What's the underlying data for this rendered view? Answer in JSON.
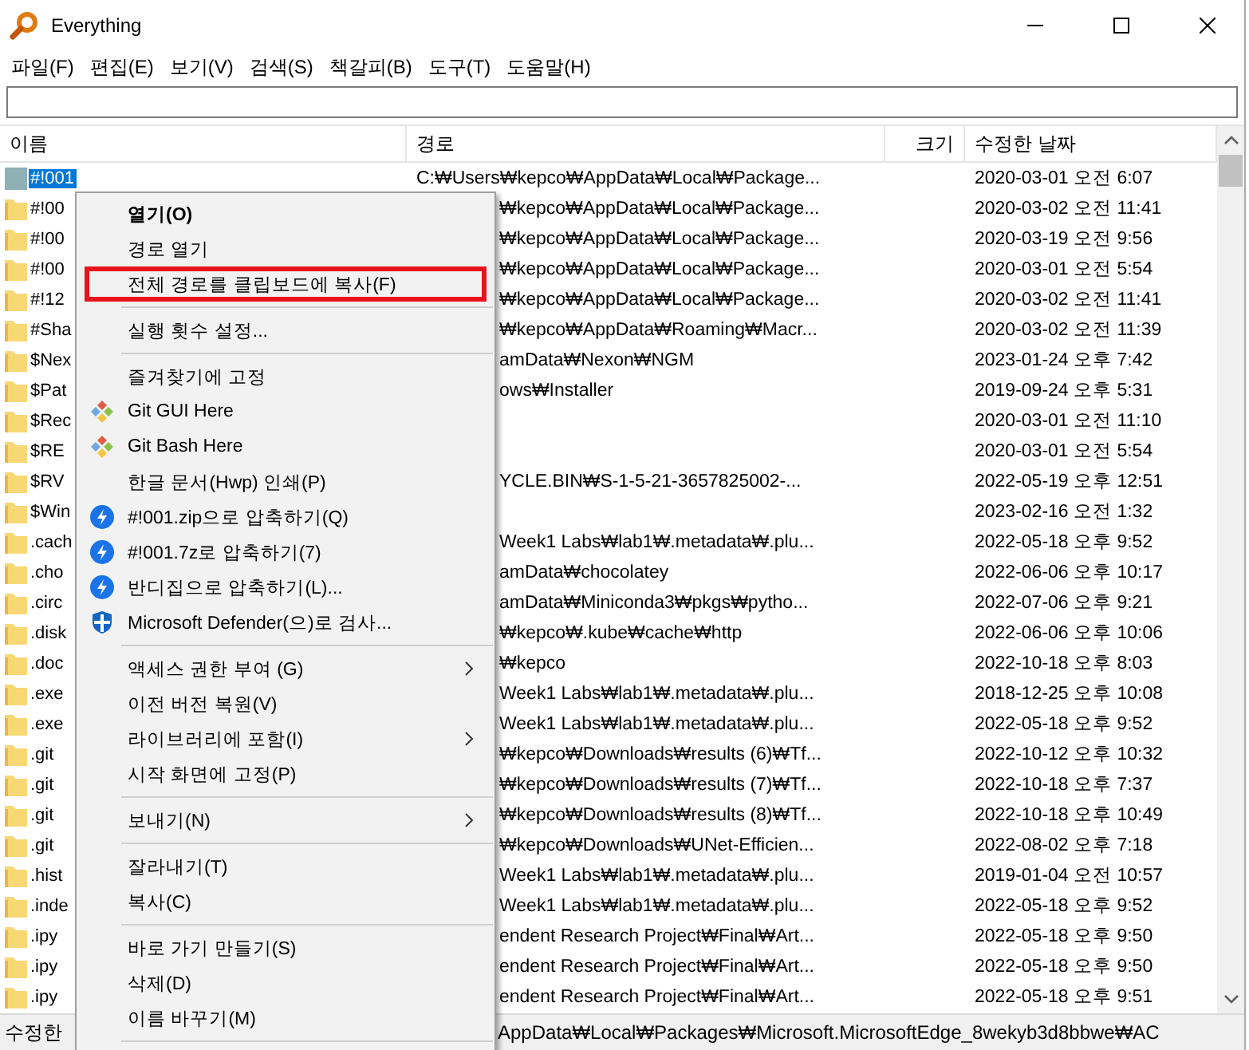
{
  "window": {
    "title": "Everything"
  },
  "menu_bar": [
    "파일(F)",
    "편집(E)",
    "보기(V)",
    "검색(S)",
    "책갈피(B)",
    "도구(T)",
    "도움말(H)"
  ],
  "columns": [
    "이름",
    "경로",
    "크기",
    "수정한 날짜"
  ],
  "rows": [
    {
      "kind": "file",
      "name": "#!001",
      "path": "C:₩Users₩kepco₩AppData₩Local₩Package...",
      "date": "2020-03-01 오전 6:07",
      "selected": true
    },
    {
      "kind": "folder",
      "name": "#!00",
      "path": "₩kepco₩AppData₩Local₩Package...",
      "date": "2020-03-02 오전 11:41",
      "selected": false
    },
    {
      "kind": "folder",
      "name": "#!00",
      "path": "₩kepco₩AppData₩Local₩Package...",
      "date": "2020-03-19 오전 9:56",
      "selected": false
    },
    {
      "kind": "folder",
      "name": "#!00",
      "path": "₩kepco₩AppData₩Local₩Package...",
      "date": "2020-03-01 오전 5:54",
      "selected": false
    },
    {
      "kind": "folder",
      "name": "#!12",
      "path": "₩kepco₩AppData₩Local₩Package...",
      "date": "2020-03-02 오전 11:41",
      "selected": false
    },
    {
      "kind": "folder",
      "name": "#Sha",
      "path": "₩kepco₩AppData₩Roaming₩Macr...",
      "date": "2020-03-02 오전 11:39",
      "selected": false
    },
    {
      "kind": "folder",
      "name": "$Nex",
      "path": "amData₩Nexon₩NGM",
      "date": "2023-01-24 오후 7:42",
      "selected": false
    },
    {
      "kind": "folder",
      "name": "$Pat",
      "path": "ows₩Installer",
      "date": "2019-09-24 오후 5:31",
      "selected": false
    },
    {
      "kind": "folder",
      "name": "$Rec",
      "path": "",
      "date": "2020-03-01 오전 11:10",
      "selected": false
    },
    {
      "kind": "folder",
      "name": "$RE",
      "path": "",
      "date": "2020-03-01 오전 5:54",
      "selected": false
    },
    {
      "kind": "folder",
      "name": "$RV",
      "path": "YCLE.BIN₩S-1-5-21-3657825002-...",
      "date": "2022-05-19 오후 12:51",
      "selected": false
    },
    {
      "kind": "folder",
      "name": "$Win",
      "path": "",
      "date": "2023-02-16 오전 1:32",
      "selected": false
    },
    {
      "kind": "folder",
      "name": ".cach",
      "path": "Week1 Labs₩lab1₩.metadata₩.plu...",
      "date": "2022-05-18 오후 9:52",
      "selected": false
    },
    {
      "kind": "folder",
      "name": ".cho",
      "path": "amData₩chocolatey",
      "date": "2022-06-06 오후 10:17",
      "selected": false
    },
    {
      "kind": "folder",
      "name": ".circ",
      "path": "amData₩Miniconda3₩pkgs₩pytho...",
      "date": "2022-07-06 오후 9:21",
      "selected": false
    },
    {
      "kind": "folder",
      "name": ".disk",
      "path": "₩kepco₩.kube₩cache₩http",
      "date": "2022-06-06 오후 10:06",
      "selected": false
    },
    {
      "kind": "folder",
      "name": ".doc",
      "path": "₩kepco",
      "date": "2022-10-18 오후 8:03",
      "selected": false
    },
    {
      "kind": "folder",
      "name": ".exe",
      "path": "Week1 Labs₩lab1₩.metadata₩.plu...",
      "date": "2018-12-25 오후 10:08",
      "selected": false
    },
    {
      "kind": "folder",
      "name": ".exe",
      "path": "Week1 Labs₩lab1₩.metadata₩.plu...",
      "date": "2022-05-18 오후 9:52",
      "selected": false
    },
    {
      "kind": "folder",
      "name": ".git",
      "path": "₩kepco₩Downloads₩results (6)₩Tf...",
      "date": "2022-10-12 오후 10:32",
      "selected": false
    },
    {
      "kind": "folder",
      "name": ".git",
      "path": "₩kepco₩Downloads₩results (7)₩Tf...",
      "date": "2022-10-18 오후 7:37",
      "selected": false
    },
    {
      "kind": "folder",
      "name": ".git",
      "path": "₩kepco₩Downloads₩results (8)₩Tf...",
      "date": "2022-10-18 오후 10:49",
      "selected": false
    },
    {
      "kind": "folder",
      "name": ".git",
      "path": "₩kepco₩Downloads₩UNet-Efficien...",
      "date": "2022-08-02 오후 7:18",
      "selected": false
    },
    {
      "kind": "folder",
      "name": ".hist",
      "path": "Week1 Labs₩lab1₩.metadata₩.plu...",
      "date": "2019-01-04 오전 10:57",
      "selected": false
    },
    {
      "kind": "folder",
      "name": ".inde",
      "path": "Week1 Labs₩lab1₩.metadata₩.plu...",
      "date": "2022-05-18 오후 9:52",
      "selected": false
    },
    {
      "kind": "folder",
      "name": ".ipy",
      "path": "endent Research Project₩Final₩Art...",
      "date": "2022-05-18 오후 9:50",
      "selected": false
    },
    {
      "kind": "folder",
      "name": ".ipy",
      "path": "endent Research Project₩Final₩Art...",
      "date": "2022-05-18 오후 9:50",
      "selected": false
    },
    {
      "kind": "folder",
      "name": ".ipy",
      "path": "endent Research Project₩Final₩Art...",
      "date": "2022-05-18 오후 9:51",
      "selected": false
    }
  ],
  "context_menu": [
    {
      "kind": "item",
      "label": "열기(O)",
      "default": true,
      "highlighted": false
    },
    {
      "kind": "item",
      "label": "경로 열기",
      "default": false,
      "highlighted": false
    },
    {
      "kind": "item",
      "label": "전체 경로를 클립보드에 복사(F)",
      "default": false,
      "highlighted": true
    },
    {
      "kind": "separator"
    },
    {
      "kind": "item",
      "label": "실행 횟수 설정...",
      "default": false,
      "highlighted": false
    },
    {
      "kind": "separator"
    },
    {
      "kind": "item",
      "label": "즐겨찾기에 고정",
      "default": false,
      "highlighted": false
    },
    {
      "kind": "item",
      "label": "Git GUI Here",
      "default": false,
      "highlighted": false
    },
    {
      "kind": "item",
      "label": "Git Bash Here",
      "default": false,
      "highlighted": false
    },
    {
      "kind": "item",
      "label": "한글 문서(Hwp) 인쇄(P)",
      "default": false,
      "highlighted": false
    },
    {
      "kind": "item",
      "label": "#!001.zip으로 압축하기(Q)",
      "default": false,
      "highlighted": false
    },
    {
      "kind": "item",
      "label": "#!001.7z로 압축하기(7)",
      "default": false,
      "highlighted": false
    },
    {
      "kind": "item",
      "label": "반디집으로 압축하기(L)...",
      "default": false,
      "highlighted": false
    },
    {
      "kind": "item",
      "label": "Microsoft Defender(으)로 검사...",
      "default": false,
      "highlighted": false
    },
    {
      "kind": "separator"
    },
    {
      "kind": "submenu",
      "label": "액세스 권한 부여 (G)",
      "default": false,
      "highlighted": false
    },
    {
      "kind": "item",
      "label": "이전 버전 복원(V)",
      "default": false,
      "highlighted": false
    },
    {
      "kind": "submenu",
      "label": "라이브러리에 포함(I)",
      "default": false,
      "highlighted": false
    },
    {
      "kind": "item",
      "label": "시작 화면에 고정(P)",
      "default": false,
      "highlighted": false
    },
    {
      "kind": "separator"
    },
    {
      "kind": "submenu",
      "label": "보내기(N)",
      "default": false,
      "highlighted": false
    },
    {
      "kind": "separator"
    },
    {
      "kind": "item",
      "label": "잘라내기(T)",
      "default": false,
      "highlighted": false
    },
    {
      "kind": "item",
      "label": "복사(C)",
      "default": false,
      "highlighted": false
    },
    {
      "kind": "separator"
    },
    {
      "kind": "item",
      "label": "바로 가기 만들기(S)",
      "default": false,
      "highlighted": false
    },
    {
      "kind": "item",
      "label": "삭제(D)",
      "default": false,
      "highlighted": false
    },
    {
      "kind": "item",
      "label": "이름 바꾸기(M)",
      "default": false,
      "highlighted": false
    },
    {
      "kind": "separator"
    }
  ],
  "status_bar": {
    "left": "수정한",
    "right": "AppData₩Local₩Packages₩Microsoft.MicrosoftEdge_8wekyb3d8bbwe₩AC"
  }
}
